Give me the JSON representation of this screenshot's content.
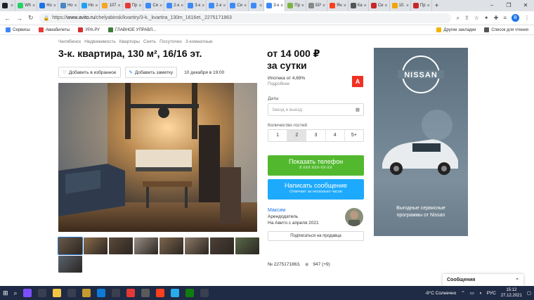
{
  "browser": {
    "tabs": [
      {
        "label": "",
        "color": "#202124"
      },
      {
        "label": "Wh",
        "color": "#25d366"
      },
      {
        "label": "Но",
        "color": "#1a73e8"
      },
      {
        "label": "Но",
        "color": "#4a86c5"
      },
      {
        "label": "Но",
        "color": "#1da1f2"
      },
      {
        "label": "107",
        "color": "#f5a623"
      },
      {
        "label": "Пр",
        "color": "#e53935"
      },
      {
        "label": "Си",
        "color": "#3d8af7"
      },
      {
        "label": "2-к",
        "color": "#3d8af7"
      },
      {
        "label": "3-к",
        "color": "#3d8af7"
      },
      {
        "label": "2-к",
        "color": "#3d8af7"
      },
      {
        "label": "Си",
        "color": "#3d8af7"
      },
      {
        "label": "",
        "color": "#3d8af7"
      },
      {
        "label": "3-к",
        "color": "#3d8af7"
      },
      {
        "label": "Пр",
        "color": "#7cb342"
      },
      {
        "label": "БР",
        "color": "#888888"
      },
      {
        "label": "Ян",
        "color": "#fc3f1d"
      },
      {
        "label": "Ка",
        "color": "#555555"
      },
      {
        "label": "Си",
        "color": "#c62828"
      },
      {
        "label": "10.",
        "color": "#f0a500"
      },
      {
        "label": "Пр",
        "color": "#c62828"
      }
    ],
    "new_tab": "+",
    "window_controls": [
      "–",
      "❐",
      "✕"
    ],
    "url_scheme": "https://",
    "url_host": "www.avito.ru",
    "url_path": "/chelyabinsk/kvartiry/3-k._kvartira_130m_1616et._2275171863",
    "profile_letter": "B",
    "bookmarks": [
      {
        "label": "Сервисы",
        "color": "#4285f4"
      },
      {
        "label": "Авиабилеты",
        "color": "#e53935"
      },
      {
        "label": "УРА.РУ",
        "color": "#d32f2f"
      },
      {
        "label": "ГЛАВНОЕ УПРАВЛ...",
        "color": "#3f7d3a"
      }
    ],
    "bookmarks_right": [
      {
        "label": "Другие закладки",
        "color": "#f4b400"
      },
      {
        "label": "Список для чтения",
        "color": "#555555"
      }
    ]
  },
  "listing": {
    "breadcrumbs": [
      "Челябинск",
      "Недвижимость",
      "Квартиры",
      "Снять",
      "Посуточно",
      "3-комнатные"
    ],
    "title": "3-к. квартира, 130 м², 16/16 эт.",
    "favorite_label": "Добавить в избранное",
    "note_label": "Добавить заметку",
    "date": "10 декабря в 19:00",
    "price_line1": "от 14 000 ₽",
    "price_line2": "за сутки",
    "mortgage": "Ипотека от 4,69%",
    "mortgage_more": "Подробнее",
    "bank_letter": "А",
    "dates_label": "Даты",
    "dates_placeholder": "Заезд и выезд",
    "guests_label": "Количество гостей",
    "guest_options": [
      "1",
      "2",
      "3",
      "4",
      "5+"
    ],
    "guest_selected": "2",
    "phone_button": "Показать телефон",
    "phone_masked": "8 XXX XXX-XX-XX",
    "message_button": "Написать сообщение",
    "message_sub": "Отвечает за несколько часов",
    "seller_name": "Максим",
    "seller_role": "Арендодатель",
    "seller_since": "На Авито с апреля 2021",
    "subscribe_label": "Подписаться на продавца",
    "listing_id": "№ 2275171863,",
    "views": "947 (+9)"
  },
  "ad": {
    "brand": "NISSAN",
    "text_line1": "Выгодные сервисные",
    "text_line2": "программы от Nissan"
  },
  "messages_bar": {
    "label": "Сообщения"
  },
  "taskbar": {
    "weather": "-9°C Солнечно",
    "lang": "РУС",
    "time": "15:12",
    "date": "27.12.2021",
    "apps": [
      "#7b4fff",
      "#3a3f4f",
      "#f4c542",
      "#3a3f4f",
      "#c49b30",
      "#0f7bd8",
      "#3a3f4f",
      "#e53935",
      "#5a5a5a",
      "#fc3f1d",
      "#2aabee",
      "#107c10",
      "#3a3f4f"
    ]
  }
}
